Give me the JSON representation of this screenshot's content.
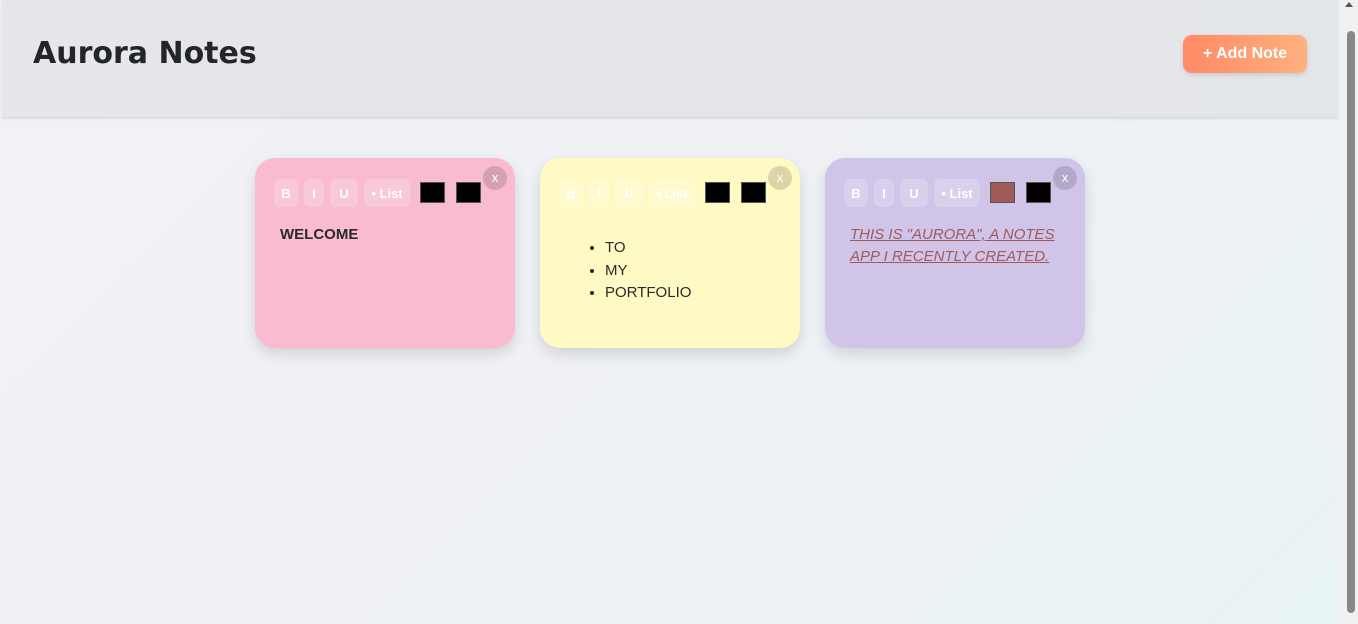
{
  "app": {
    "title": "Aurora Notes",
    "add_note_label": "+ Add Note"
  },
  "toolbar": {
    "bold_label": "B",
    "italic_label": "I",
    "underline_label": "U",
    "list_label": "• List",
    "close_label": "x"
  },
  "notes": [
    {
      "color": "#f8bbd0",
      "swatches": [
        "#000000",
        "#000000"
      ],
      "text": "WELCOME"
    },
    {
      "color": "#fff9c4",
      "swatches": [
        "#000000",
        "#000000"
      ],
      "items": [
        "TO",
        "MY",
        "PORTFOLIO"
      ]
    },
    {
      "color": "#d1c4e9",
      "swatches": [
        "#a05a58",
        "#000000"
      ],
      "text": "THIS IS \"AURORA\", A NOTES APP I RECENTLY CREATED."
    }
  ]
}
